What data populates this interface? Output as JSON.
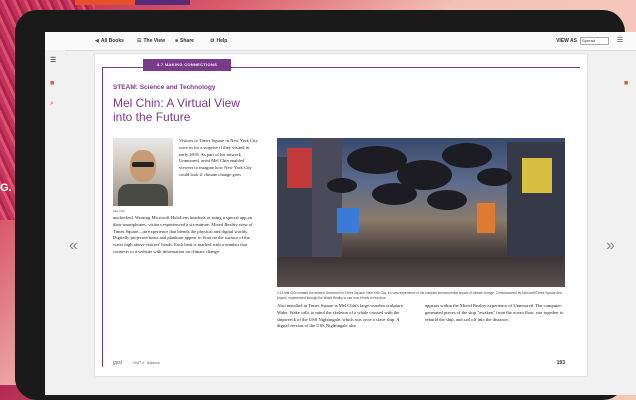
{
  "background": {
    "text": "G."
  },
  "toolbar": {
    "items": [
      {
        "icon": "arrow-left-icon",
        "label": "All Books"
      },
      {
        "icon": "list-icon",
        "label": "The View"
      },
      {
        "icon": "share-icon",
        "label": "Share"
      },
      {
        "icon": "help-icon",
        "label": "Help"
      }
    ],
    "view_as_label": "VIEW AS",
    "view_as_value": "Spread"
  },
  "page": {
    "unit_tab": "4.7 MAKING CONNECTIONS",
    "section": "STEAM: Science and Technology",
    "title": "Mel Chin: A Virtual View into the Future",
    "photo_caption": "Mel Chin",
    "body_right_of_photo": "Visitors to Times Square in New York City were in for a surprise if they visited in early 2018. As part of his artwork Unmoored, artist Mel Chin enabled viewers to imagine how New York City could look if climate change goes",
    "body_left": "unchecked. Wearing Microsoft HoloLens headsets or using a special app on their smartphones, visitors experienced a six-minute, Mixed Reality view of Times Square—an experience that blends the physical and digital worlds. Digitally projected boats and plankton appear to float on the surface of the water high above visitors' heads. Each boat is marked with a number that connects to a website with information on climate change.",
    "main_photo_caption": "4.13 Mel Chin created the artwork Unmoored in Times Square, New York City. It's view experience of the complex environmental impact of climate change. Commissioned by Microsoft/Times Square Arts project, experienced through the Mixed Reality to see how it feels in real time.",
    "col2": "Also installed in Times Square is Mel Chin's large wooden sculpture, Wake. Wake calls to mind the skeleton of a whale crossed with the shipwreck of the USS Nightingale, which was once a slave ship. A digital version of the USS Nightingale also",
    "col3": "appears within the Mixed Reality experience of Unmoored. The computer-generated pieces of the ship \"awaken\" from the ocean floor, rise together to rebuild the ship, and sail off into the distance.",
    "footer_logo": "gyst",
    "footer_unit": "UNIT 4 · Balance",
    "page_number": "193"
  },
  "nav": {
    "prev": "«",
    "next": "»"
  },
  "colors": {
    "accent": "#7b3a8a",
    "frame": "#1a1a1a"
  }
}
